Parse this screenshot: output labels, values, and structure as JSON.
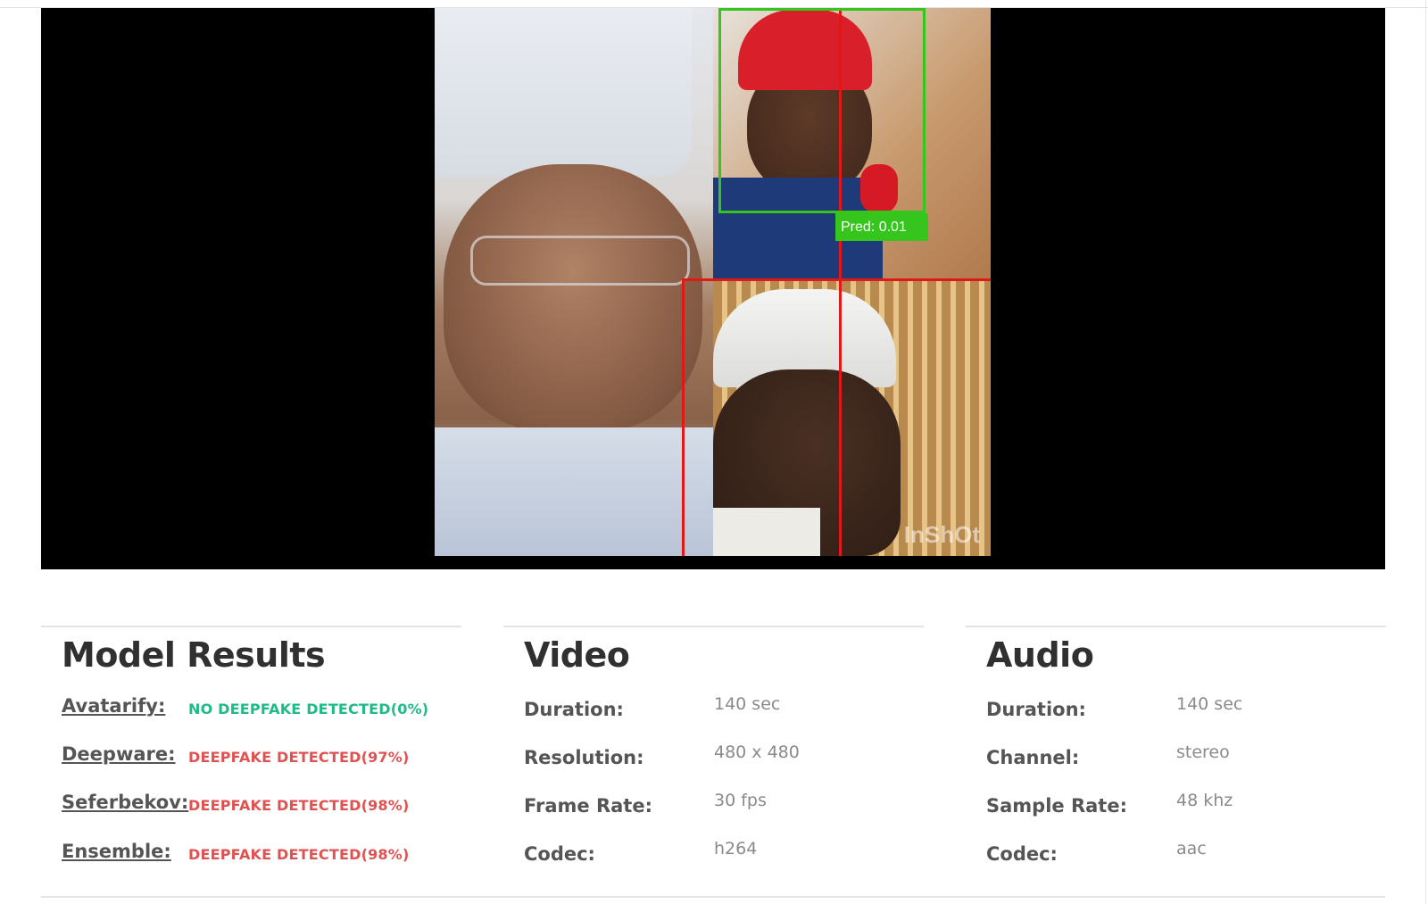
{
  "video_frame": {
    "prediction_label": "Pred: 0.01",
    "watermark": "InShOt"
  },
  "model_results": {
    "title": "Model Results",
    "items": [
      {
        "name": "Avatarify:",
        "result": "NO DEEPFAKE DETECTED(0%)",
        "status": "ok",
        "color": "#1fba86"
      },
      {
        "name": "Deepware:",
        "result": "DEEPFAKE DETECTED(97%)",
        "status": "bad",
        "color": "#e05252"
      },
      {
        "name": "Seferbekov:",
        "result": "DEEPFAKE DETECTED(98%)",
        "status": "bad",
        "color": "#e05252"
      },
      {
        "name": "Ensemble:",
        "result": "DEEPFAKE DETECTED(98%)",
        "status": "bad",
        "color": "#e05252"
      }
    ]
  },
  "video": {
    "title": "Video",
    "rows": [
      {
        "label": "Duration:",
        "value": "140 sec"
      },
      {
        "label": "Resolution:",
        "value": "480 x 480"
      },
      {
        "label": "Frame Rate:",
        "value": "30 fps"
      },
      {
        "label": "Codec:",
        "value": "h264"
      }
    ]
  },
  "audio": {
    "title": "Audio",
    "rows": [
      {
        "label": "Duration:",
        "value": "140 sec"
      },
      {
        "label": "Channel:",
        "value": "stereo"
      },
      {
        "label": "Sample Rate:",
        "value": "48 khz"
      },
      {
        "label": "Codec:",
        "value": "aac"
      }
    ]
  },
  "colors": {
    "detection_box_real": "#35c51d",
    "detection_box_fake": "#e01818",
    "ok": "#1fba86",
    "bad": "#e05252"
  }
}
